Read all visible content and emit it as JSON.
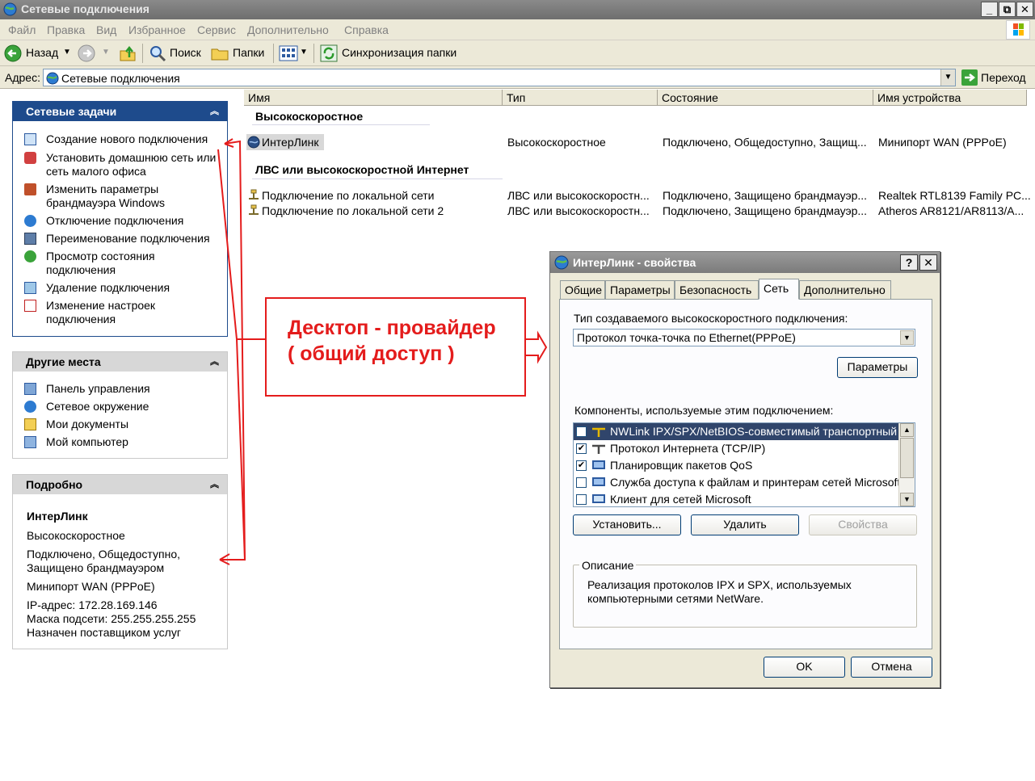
{
  "window": {
    "title": "Сетевые подключения",
    "controls": [
      "_",
      "⧉",
      "✕"
    ]
  },
  "menu": [
    "Файл",
    "Правка",
    "Вид",
    "Избранное",
    "Сервис",
    "Дополнительно",
    "Справка"
  ],
  "toolbar": {
    "back": "Назад",
    "search": "Поиск",
    "folders": "Папки",
    "sync": "Синхронизация папки"
  },
  "address": {
    "label": "Адрес:",
    "value": "Сетевые подключения",
    "go": "Переход"
  },
  "network_tasks": {
    "title": "Сетевые задачи",
    "items": [
      {
        "label": "Создание нового подключения",
        "icon": "new-connection-icon"
      },
      {
        "label": "Установить домашнюю сеть или сеть малого офиса",
        "icon": "home-network-icon"
      },
      {
        "label": "Изменить параметры брандмауэра Windows",
        "icon": "firewall-icon"
      },
      {
        "label": "Отключение подключения",
        "icon": "disconnect-icon"
      },
      {
        "label": "Переименование подключения",
        "icon": "rename-icon"
      },
      {
        "label": "Просмотр состояния подключения",
        "icon": "status-icon"
      },
      {
        "label": "Удаление подключения",
        "icon": "delete-icon"
      },
      {
        "label": "Изменение настроек подключения",
        "icon": "settings-icon"
      }
    ]
  },
  "other_places": {
    "title": "Другие места",
    "items": [
      {
        "label": "Панель управления",
        "icon": "control-panel-icon"
      },
      {
        "label": "Сетевое окружение",
        "icon": "network-places-icon"
      },
      {
        "label": "Мои документы",
        "icon": "documents-icon"
      },
      {
        "label": "Мой компьютер",
        "icon": "computer-icon"
      }
    ]
  },
  "details": {
    "title": "Подробно",
    "name": "ИнтерЛинк",
    "type": "Высокоскоростное",
    "status": "Подключено, Общедоступно, Защищено брандмауэром",
    "device": "Минипорт WAN (PPPoE)",
    "ip": "IP-адрес: 172.28.169.146",
    "mask": "Маска подсети: 255.255.255.255",
    "assigned": "Назначен поставщиком услуг"
  },
  "list": {
    "columns": [
      "Имя",
      "Тип",
      "Состояние",
      "Имя устройства"
    ],
    "groups": [
      {
        "title": "Высокоскоростное",
        "rows": [
          {
            "name": "ИнтерЛинк",
            "type": "Высокоскоростное",
            "status": "Подключено, Общедоступно, Защищ...",
            "device": "Минипорт WAN (PPPoE)"
          }
        ]
      },
      {
        "title": "ЛВС или высокоскоростной Интернет",
        "rows": [
          {
            "name": "Подключение по локальной сети",
            "type": "ЛВС или высокоскоростн...",
            "status": "Подключено, Защищено брандмауэр...",
            "device": "Realtek RTL8139 Family PC..."
          },
          {
            "name": "Подключение по локальной сети 2",
            "type": "ЛВС или высокоскоростн...",
            "status": "Подключено, Защищено брандмауэр...",
            "device": "Atheros AR8121/AR8113/A..."
          }
        ]
      }
    ]
  },
  "annotation": {
    "line1": "Десктоп - провайдер",
    "line2": "( общий доступ )",
    "color": "#e41c1c"
  },
  "dialog": {
    "title": "ИнтерЛинк - свойства",
    "help": "?",
    "close": "✕",
    "tabs": [
      "Общие",
      "Параметры",
      "Безопасность",
      "Сеть",
      "Дополнительно"
    ],
    "active_tab": "Сеть",
    "type_label": "Тип создаваемого высокоскоростного подключения:",
    "type_value": "Протокол точка-точка по Ethernet(PPPoE)",
    "settings_button": "Параметры",
    "components_label": "Компоненты, используемые этим подключением:",
    "components": [
      {
        "label": "NWLink IPX/SPX/NetBIOS-совместимый транспортный ...",
        "checked": false,
        "selected": true
      },
      {
        "label": "Протокол Интернета (TCP/IP)",
        "checked": true,
        "selected": false
      },
      {
        "label": "Планировщик пакетов QoS",
        "checked": true,
        "selected": false
      },
      {
        "label": "Служба доступа к файлам и принтерам сетей Microsoft",
        "checked": false,
        "selected": false
      },
      {
        "label": "Клиент для сетей Microsoft",
        "checked": false,
        "selected": false
      }
    ],
    "install": "Установить...",
    "remove": "Удалить",
    "properties": "Свойства",
    "description_label": "Описание",
    "description": "Реализация протоколов IPX и SPX, используемых компьютерными сетями NetWare.",
    "ok": "OK",
    "cancel": "Отмена"
  }
}
